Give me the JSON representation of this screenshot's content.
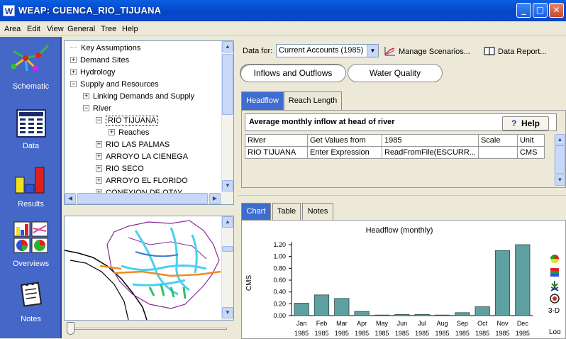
{
  "window": {
    "app_letter": "W",
    "title": "WEAP: CUENCA_RIO_TIJUANA",
    "minimize": "_",
    "maximize": "□",
    "close": "✕"
  },
  "menu": [
    "Area",
    "Edit",
    "View",
    "General",
    "Tree",
    "Help"
  ],
  "nav": [
    {
      "label": "Schematic",
      "icon": "schematic-icon"
    },
    {
      "label": "Data",
      "icon": "data-icon"
    },
    {
      "label": "Results",
      "icon": "results-icon"
    },
    {
      "label": "Overviews",
      "icon": "overviews-icon"
    },
    {
      "label": "Notes",
      "icon": "notes-icon"
    }
  ],
  "tree": [
    {
      "label": "Key Assumptions",
      "toggle": ""
    },
    {
      "label": "Demand Sites",
      "toggle": "+"
    },
    {
      "label": "Hydrology",
      "toggle": "+"
    },
    {
      "label": "Supply and Resources",
      "toggle": "−"
    },
    {
      "label": "Linking Demands and Supply",
      "toggle": "+"
    },
    {
      "label": "River",
      "toggle": "−"
    },
    {
      "label": "RIO TIJUANA",
      "toggle": "−"
    },
    {
      "label": "Reaches",
      "toggle": "+"
    },
    {
      "label": "RIO LAS PALMAS",
      "toggle": "+"
    },
    {
      "label": "ARROYO LA CIENEGA",
      "toggle": "+"
    },
    {
      "label": "RIO SECO",
      "toggle": "+"
    },
    {
      "label": "ARROYO EL FLORIDO",
      "toggle": "+"
    },
    {
      "label": "CONEXION DE OTAY",
      "toggle": "+"
    }
  ],
  "toolbar": {
    "data_for_label": "Data for:",
    "scenario_value": "Current Accounts (1985)",
    "manage_scenarios": "Manage Scenarios...",
    "data_report": "Data Report..."
  },
  "category_buttons": [
    "Inflows and Outflows",
    "Water Quality"
  ],
  "data_tabs": [
    "Headflow",
    "Reach Length"
  ],
  "grid": {
    "title": "Average monthly inflow at head of river",
    "help_label": "Help",
    "help_glyph": "?",
    "headers": [
      "River",
      "Get Values from",
      "1985",
      "Scale",
      "Unit"
    ],
    "rows": [
      [
        "RIO TIJUANA",
        "Enter Expression",
        "ReadFromFile(ESCURR...",
        "",
        "CMS"
      ]
    ]
  },
  "result_tabs": [
    "Chart",
    "Table",
    "Notes"
  ],
  "chart_toolbar": {
    "label_3d": "3-D",
    "label_log": "Log"
  },
  "chart_data": {
    "type": "bar",
    "title": "Headflow (monthly)",
    "ylabel": "CMS",
    "xlabel": "",
    "categories": [
      "Jan",
      "Feb",
      "Mar",
      "Apr",
      "May",
      "Jun",
      "Jul",
      "Aug",
      "Sep",
      "Oct",
      "Nov",
      "Dec"
    ],
    "year_label": "1985",
    "values": [
      0.21,
      0.35,
      0.29,
      0.07,
      0.01,
      0.02,
      0.02,
      0.01,
      0.05,
      0.15,
      1.1,
      1.2
    ],
    "yticks": [
      "1.20",
      "1.00",
      "0.80",
      "0.60",
      "0.40",
      "0.20",
      "0.00"
    ],
    "ylim": [
      0,
      1.2
    ],
    "grid": false,
    "bar_color": "#5fa0a0"
  }
}
